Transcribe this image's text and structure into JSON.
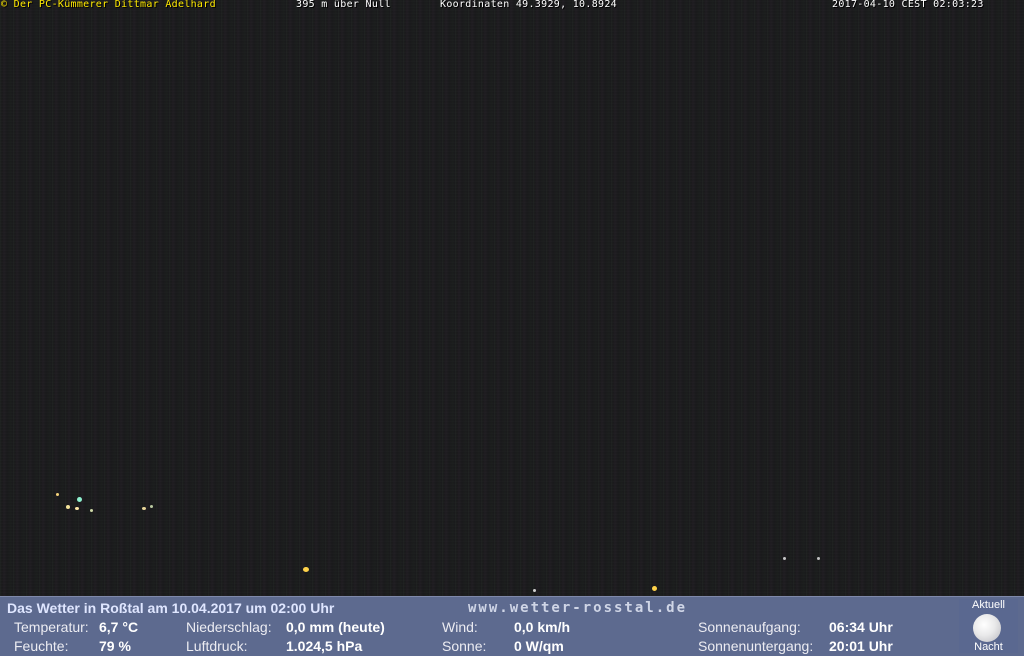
{
  "overlay": {
    "copyright": "© Der PC-Kümmerer Dittmar Adelhard",
    "altitude": "395 m über Null",
    "coordinates": "Koordinaten 49.3929, 10.8924",
    "timestamp": "2017-04-10 CEST 02:03:23"
  },
  "weather": {
    "title": "Das Wetter in Roßtal am 10.04.2017 um 02:00 Uhr",
    "website": "www.wetter-rosstal.de",
    "temperature": {
      "label": "Temperatur:",
      "value": "6,7 °C"
    },
    "humidity": {
      "label": "Feuchte:",
      "value": "79 %"
    },
    "precipitation": {
      "label": "Niederschlag:",
      "value": "0,0 mm (heute)"
    },
    "pressure": {
      "label": "Luftdruck:",
      "value": "1.024,5 hPa"
    },
    "wind": {
      "label": "Wind:",
      "value": "0,0 km/h"
    },
    "sun": {
      "label": "Sonne:",
      "value": "0 W/qm"
    },
    "sunrise": {
      "label": "Sonnenaufgang:",
      "value": "06:34 Uhr"
    },
    "sunset": {
      "label": "Sonnenuntergang:",
      "value": "20:01 Uhr"
    },
    "moon": {
      "top": "Aktuell",
      "bottom": "Nacht",
      "icon": "moon-icon"
    }
  },
  "colors": {
    "panel": "#5d6a8f",
    "overlay_yellow": "#ffea00",
    "overlay_white": "#ffffff"
  }
}
